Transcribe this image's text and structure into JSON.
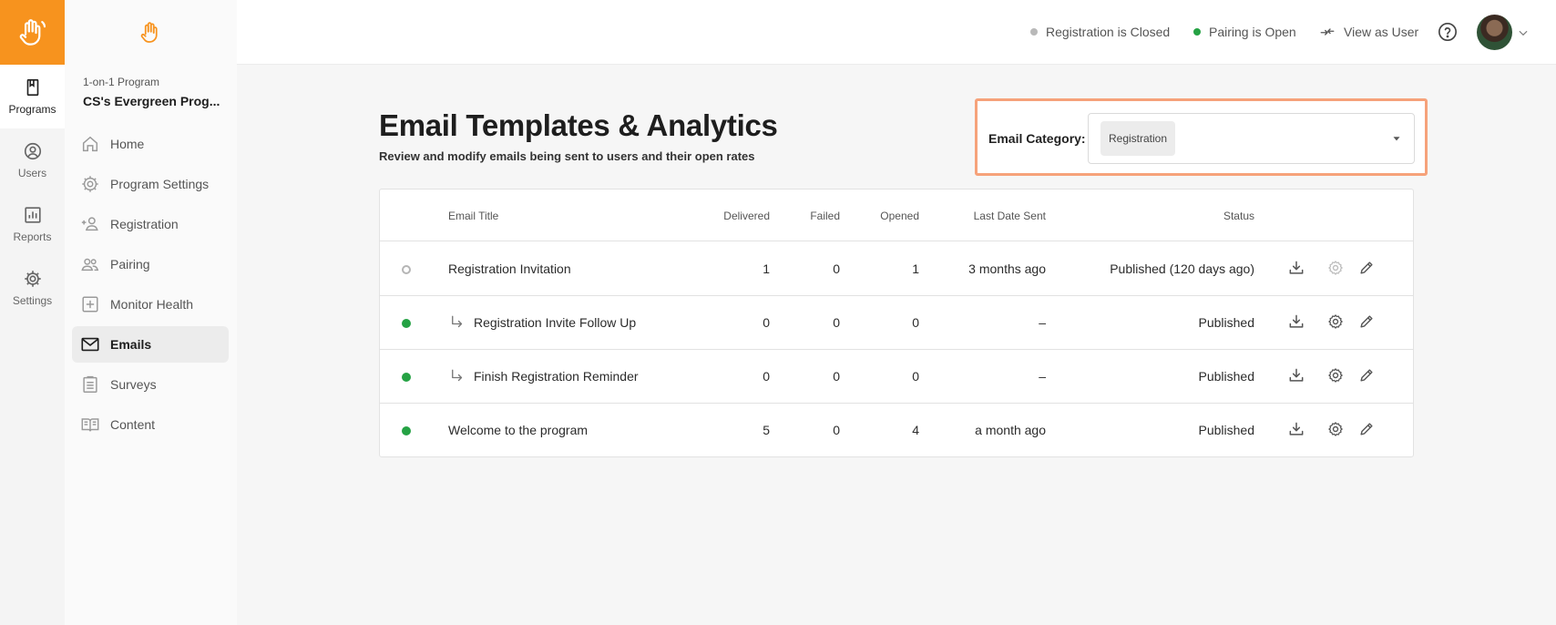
{
  "rail": {
    "items": [
      {
        "label": "Programs",
        "icon": "book-icon",
        "active": true
      },
      {
        "label": "Users",
        "icon": "user-circle-icon",
        "active": false
      },
      {
        "label": "Reports",
        "icon": "bar-chart-icon",
        "active": false
      },
      {
        "label": "Settings",
        "icon": "gear-icon",
        "active": false
      }
    ]
  },
  "sidebar": {
    "program_type": "1-on-1 Program",
    "program_name": "CS's Evergreen Prog...",
    "items": [
      {
        "label": "Home",
        "icon": "home-icon"
      },
      {
        "label": "Program Settings",
        "icon": "gear-icon"
      },
      {
        "label": "Registration",
        "icon": "person-add-icon"
      },
      {
        "label": "Pairing",
        "icon": "people-icon"
      },
      {
        "label": "Monitor Health",
        "icon": "plus-square-icon"
      },
      {
        "label": "Emails",
        "icon": "mail-icon",
        "active": true
      },
      {
        "label": "Surveys",
        "icon": "clipboard-icon"
      },
      {
        "label": "Content",
        "icon": "open-book-icon"
      }
    ]
  },
  "topbar": {
    "registration_status": "Registration is Closed",
    "pairing_status": "Pairing is Open",
    "view_as_user": "View as User",
    "colors": {
      "closed": "#b9b9b9",
      "open": "#25a244"
    }
  },
  "main": {
    "title": "Email Templates & Analytics",
    "subtitle": "Review and modify emails being sent to users and their open rates",
    "category_label": "Email Category:",
    "category_value": "Registration"
  },
  "table": {
    "headers": {
      "title": "Email Title",
      "delivered": "Delivered",
      "failed": "Failed",
      "opened": "Opened",
      "last_sent": "Last Date Sent",
      "status": "Status"
    },
    "rows": [
      {
        "state": "draft",
        "sub": false,
        "title": "Registration Invitation",
        "delivered": "1",
        "failed": "0",
        "opened": "1",
        "last_sent": "3 months ago",
        "status": "Published (120 days ago)"
      },
      {
        "state": "live",
        "sub": true,
        "title": "Registration Invite Follow Up",
        "delivered": "0",
        "failed": "0",
        "opened": "0",
        "last_sent": "–",
        "status": "Published"
      },
      {
        "state": "live",
        "sub": true,
        "title": "Finish Registration Reminder",
        "delivered": "0",
        "failed": "0",
        "opened": "0",
        "last_sent": "–",
        "status": "Published"
      },
      {
        "state": "live",
        "sub": false,
        "title": "Welcome to the program",
        "delivered": "5",
        "failed": "0",
        "opened": "4",
        "last_sent": "a month ago",
        "status": "Published"
      }
    ]
  },
  "brand": {
    "accent": "#f7931e",
    "highlight": "#f6a27a"
  }
}
